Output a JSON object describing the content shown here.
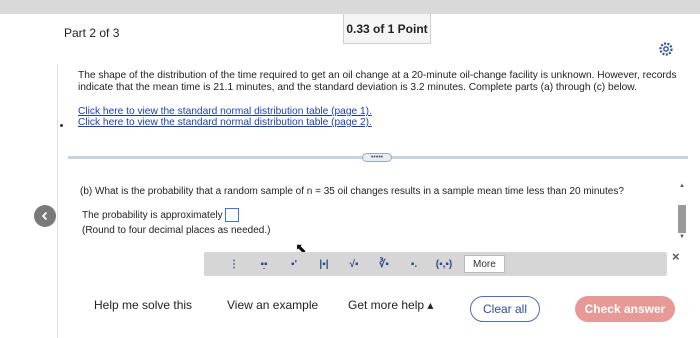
{
  "header": {
    "part_label": "Part 2 of 3",
    "points": "0.33 of 1 Point"
  },
  "problem": {
    "prompt": "The shape of the distribution of the time required to get an oil change at a 20-minute oil-change facility is unknown. However, records indicate that the mean time is 21.1 minutes, and the standard deviation is 3.2 minutes. Complete parts (a) through (c) below.",
    "link1": "Click here to view the standard normal distribution table (page 1).",
    "link2": "Click here to view the standard normal distribution table (page 2)."
  },
  "collapse_label": "•••••",
  "question": {
    "text": "(b) What is the probability that a random sample of n = 35 oil changes results in a sample mean time less than 20 minutes?",
    "answer_prefix": "The probability is approximately",
    "answer_value": "",
    "round_note": "(Round to four decimal places as needed.)"
  },
  "math_toolbar": {
    "buttons": [
      "⋮",
      "▪̣▪",
      "▪'",
      "|▪|",
      "√▪",
      "∛▪",
      "▪.",
      "(▪,▪)"
    ],
    "more_label": "More",
    "close_label": "×"
  },
  "footer": {
    "help_label": "Help me solve this",
    "example_label": "View an example",
    "more_help_label": "Get more help ▴",
    "clear_label": "Clear all",
    "check_label": "Check answer"
  },
  "colors": {
    "link": "#1a3fb5",
    "check_button": "#e79a95",
    "clear_border": "#4b6fb5",
    "input_border": "#3b73d6"
  },
  "icons": [
    "gear-icon",
    "back-arrow-icon",
    "close-icon",
    "pointer-cursor-icon"
  ]
}
